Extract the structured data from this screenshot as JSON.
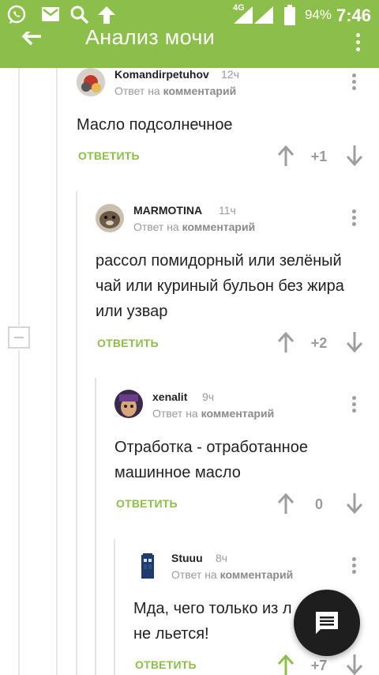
{
  "status_bar": {
    "network": "4G",
    "battery": "94%",
    "time": "7:46"
  },
  "app_bar": {
    "title": "Анализ мочи"
  },
  "comments": [
    {
      "author": "Komandirpetuhov",
      "time": "12ч",
      "reply_prefix": "Ответ на",
      "reply_target": "комментарий",
      "text_lines": [
        "Масло подсолнечное"
      ],
      "reply_label": "ОТВЕТИТЬ",
      "rating": "+1"
    },
    {
      "author": "MARMOTINA",
      "time": "11ч",
      "reply_prefix": "Ответ на",
      "reply_target": "комментарий",
      "text_lines": [
        "рассол помидорный или зелёный",
        "чай или куриный бульон без жира",
        "или узвар"
      ],
      "reply_label": "ОТВЕТИТЬ",
      "rating": "+2"
    },
    {
      "author": "xenalit",
      "time": "9ч",
      "reply_prefix": "Ответ на",
      "reply_target": "комментарий",
      "text_lines": [
        "Отработка - отработанное",
        "машинное масло"
      ],
      "reply_label": "ОТВЕТИТЬ",
      "rating": "0"
    },
    {
      "author": "Stuuu",
      "time": "8ч",
      "reply_prefix": "Ответ на",
      "reply_target": "комментарий",
      "text_lines": [
        "Мда, чего только из л",
        "не льется!"
      ],
      "reply_label": "ОТВЕТИТЬ",
      "rating": "+7"
    }
  ],
  "colors": {
    "brand_green": "#8bbf4a",
    "upvoted_green": "#8bbf4a",
    "fab_dark": "#1e1e1e"
  },
  "icons": {
    "status": [
      "whatsapp-icon",
      "mail-icon",
      "search-icon",
      "upload-icon",
      "signal-icon",
      "battery-icon"
    ],
    "app_bar": [
      "back-arrow-icon",
      "more-vert-icon"
    ],
    "fab": "comment-icon"
  }
}
